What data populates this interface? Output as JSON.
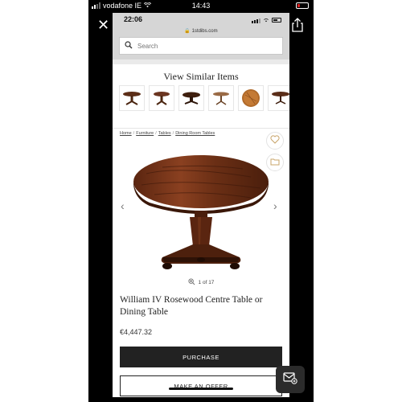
{
  "outer_status": {
    "carrier": "vodafone IE",
    "time": "14:43",
    "battery_level": 0.2
  },
  "inner_status": {
    "time": "22:06",
    "url": "1stdibs.com"
  },
  "search": {
    "placeholder": "Search"
  },
  "similar": {
    "heading": "View Similar Items",
    "items": [
      "pedestal-table-thumb",
      "pedestal-table-thumb",
      "pedestal-table-thumb",
      "pedestal-table-thumb",
      "round-tabletop-thumb",
      "pedestal-table-thumb"
    ]
  },
  "breadcrumb": [
    "Home",
    "Furniture",
    "Tables",
    "Dining Room Tables"
  ],
  "gallery": {
    "counter": "1 of 17"
  },
  "product": {
    "title": "William IV Rosewood Centre Table or Dining Table",
    "price": "€4,447.32"
  },
  "actions": {
    "purchase": "PURCHASE",
    "offer": "MAKE AN OFFER"
  },
  "colors": {
    "accent": "#222222",
    "wood": "#6b3218",
    "chrome": "#d6d6d6"
  },
  "icons": [
    "close-icon",
    "share-icon",
    "search-icon",
    "heart-icon",
    "folder-icon",
    "chevron-left-icon",
    "chevron-right-icon",
    "zoom-icon",
    "chat-icon"
  ]
}
